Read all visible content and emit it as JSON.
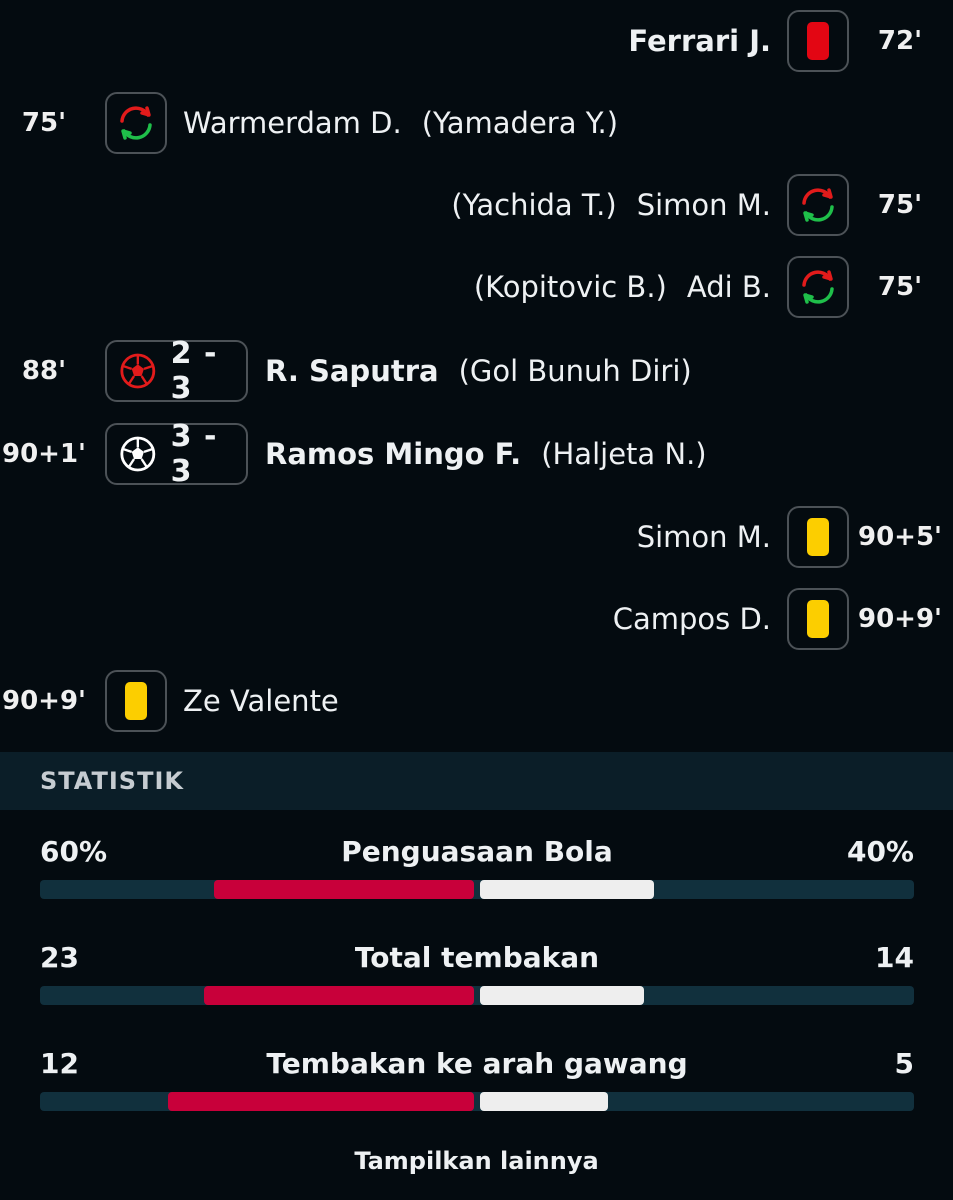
{
  "events": [
    {
      "side": "right",
      "time": "72'",
      "icon": "red-card-icon",
      "player": "Ferrari J.",
      "detail": ""
    },
    {
      "side": "left",
      "time": "75'",
      "icon": "substitution-icon",
      "player": "Warmerdam D.",
      "detail": "(Yamadera Y.)"
    },
    {
      "side": "right",
      "time": "75'",
      "icon": "substitution-icon",
      "player": "Simon M.",
      "detail": "(Yachida T.)"
    },
    {
      "side": "right",
      "time": "75'",
      "icon": "substitution-icon",
      "player": "Adi B.",
      "detail": "(Kopitovic B.)"
    },
    {
      "side": "left",
      "time": "88'",
      "icon": "own-goal-ball-icon",
      "score": "2 - 3",
      "player": "R. Saputra",
      "detail": "(Gol Bunuh Diri)"
    },
    {
      "side": "left",
      "time": "90+1'",
      "icon": "goal-ball-icon",
      "score": "3 - 3",
      "player": "Ramos Mingo F.",
      "detail": "(Haljeta N.)"
    },
    {
      "side": "right",
      "time": "90+5'",
      "icon": "yellow-card-icon",
      "player": "Simon M.",
      "detail": ""
    },
    {
      "side": "right",
      "time": "90+9'",
      "icon": "yellow-card-icon",
      "player": "Campos D.",
      "detail": ""
    },
    {
      "side": "left",
      "time": "90+9'",
      "icon": "yellow-card-icon",
      "player": "Ze Valente",
      "detail": ""
    }
  ],
  "stats_header": "STATISTIK",
  "stats": [
    {
      "name": "Penguasaan Bola",
      "home": "60%",
      "away": "40%",
      "home_value": 60,
      "away_value": 40,
      "max": 100
    },
    {
      "name": "Total tembakan",
      "home": "23",
      "away": "14",
      "home_value": 23,
      "away_value": 14,
      "max": 37
    },
    {
      "name": "Tembakan ke arah gawang",
      "home": "12",
      "away": "5",
      "home_value": 12,
      "away_value": 5,
      "max": 17
    }
  ],
  "show_more": "Tampilkan lainnya",
  "colors": {
    "red_card": "#e30613",
    "yellow_card": "#fcce00",
    "home_bar": "#c8003a",
    "away_bar": "#eeeeee",
    "sub_in": "#1fbf4a",
    "sub_out": "#e21b1b"
  }
}
